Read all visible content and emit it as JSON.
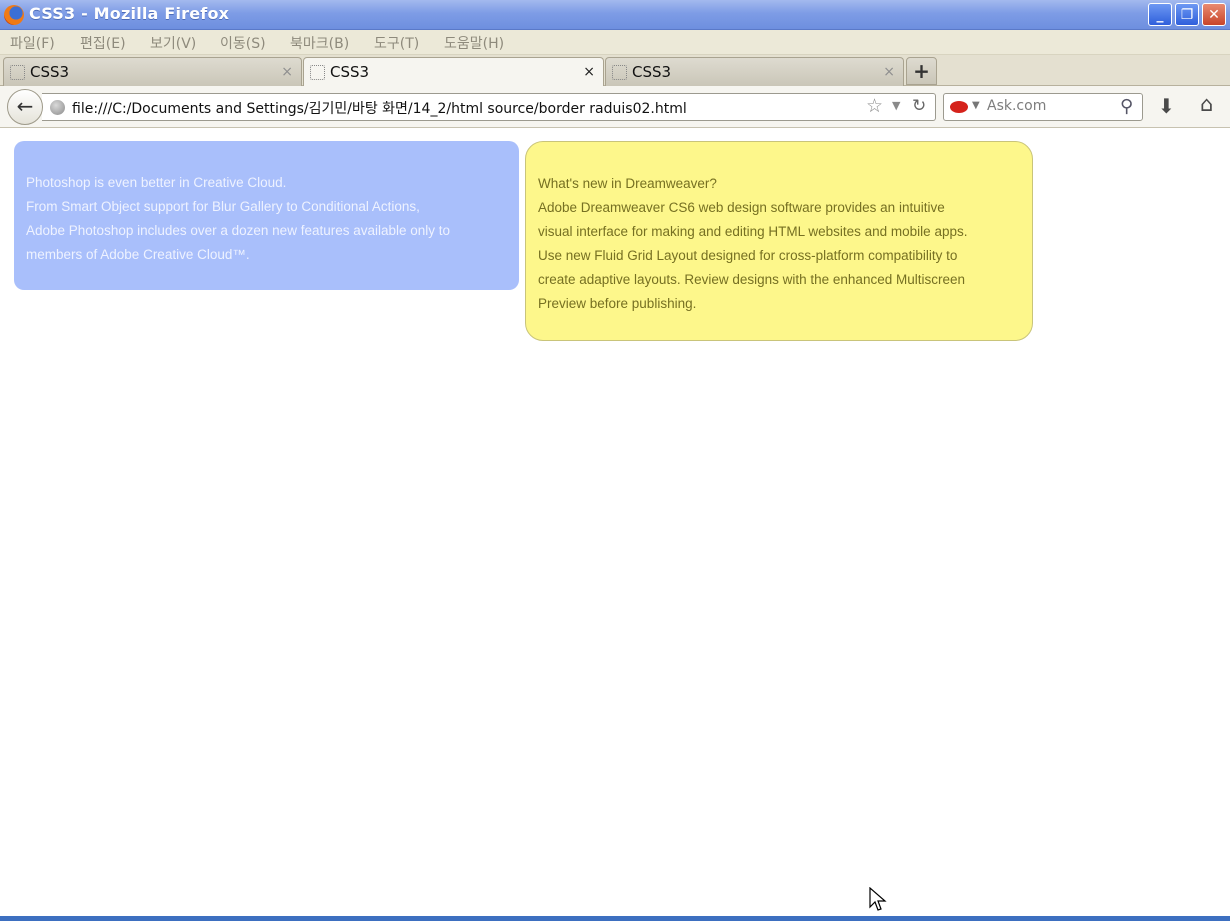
{
  "window": {
    "title": "CSS3 - Mozilla Firefox",
    "buttons": [
      "_",
      "❐",
      "✕"
    ]
  },
  "menu": [
    "파일(F)",
    "편집(E)",
    "보기(V)",
    "이동(S)",
    "북마크(B)",
    "도구(T)",
    "도움말(H)"
  ],
  "tabs": [
    {
      "label": "CSS3",
      "active": false
    },
    {
      "label": "CSS3",
      "active": true
    },
    {
      "label": "CSS3",
      "active": false
    }
  ],
  "tab_close_glyph": "×",
  "new_tab_glyph": "+",
  "nav": {
    "url": "file:///C:/Documents and Settings/김기민/바탕 화면/14_2/html source/border raduis02.html",
    "search_placeholder": "Ask.com"
  },
  "content": {
    "blue_box": [
      "Photoshop is even better in Creative Cloud.",
      "From Smart Object support for Blur Gallery to Conditional Actions,",
      "Adobe Photoshop includes over a dozen new features available only to",
      "members of Adobe Creative Cloud™."
    ],
    "yellow_box": [
      "What's new in Dreamweaver?",
      "Adobe Dreamweaver CS6 web design software provides an intuitive",
      "visual interface for making and editing HTML websites and mobile apps.",
      "Use new Fluid Grid Layout designed for cross-platform compatibility to",
      "create adaptive layouts. Review designs with the enhanced Multiscreen",
      "Preview before publishing."
    ]
  },
  "colors": {
    "blue_box_bg": "#a9bffb",
    "yellow_box_bg": "#fdf78b",
    "titlebar": "#7e9ce6"
  }
}
